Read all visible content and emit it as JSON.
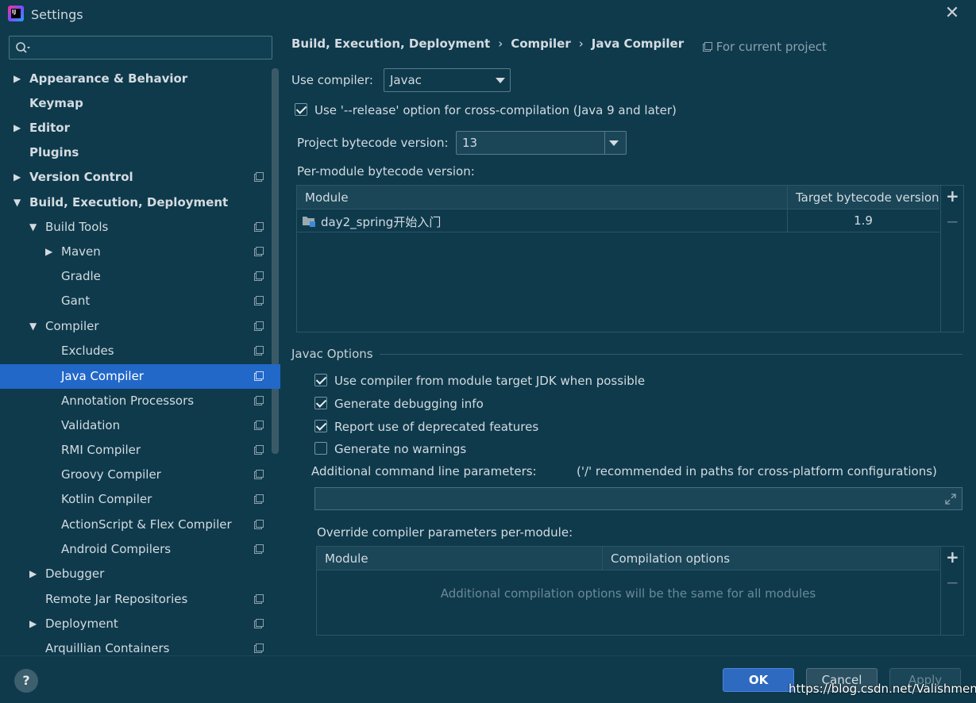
{
  "window": {
    "title": "Settings"
  },
  "search": {
    "placeholder": ""
  },
  "sidebar": {
    "items": [
      {
        "label": "Appearance & Behavior"
      },
      {
        "label": "Keymap"
      },
      {
        "label": "Editor"
      },
      {
        "label": "Plugins"
      },
      {
        "label": "Version Control"
      },
      {
        "label": "Build, Execution, Deployment"
      },
      {
        "label": "Build Tools"
      },
      {
        "label": "Maven"
      },
      {
        "label": "Gradle"
      },
      {
        "label": "Gant"
      },
      {
        "label": "Compiler"
      },
      {
        "label": "Excludes"
      },
      {
        "label": "Java Compiler"
      },
      {
        "label": "Annotation Processors"
      },
      {
        "label": "Validation"
      },
      {
        "label": "RMI Compiler"
      },
      {
        "label": "Groovy Compiler"
      },
      {
        "label": "Kotlin Compiler"
      },
      {
        "label": "ActionScript & Flex Compiler"
      },
      {
        "label": "Android Compilers"
      },
      {
        "label": "Debugger"
      },
      {
        "label": "Remote Jar Repositories"
      },
      {
        "label": "Deployment"
      },
      {
        "label": "Arquillian Containers"
      }
    ]
  },
  "breadcrumb": {
    "items": [
      "Build, Execution, Deployment",
      "Compiler",
      "Java Compiler"
    ],
    "separator": "›",
    "scope": "For current project"
  },
  "compiler": {
    "use_compiler_label": "Use compiler:",
    "use_compiler_value": "Javac",
    "release_option_label": "Use '--release' option for cross-compilation (Java 9 and later)",
    "release_option_checked": true,
    "project_bytecode_label": "Project bytecode version:",
    "project_bytecode_value": "13",
    "per_module_label": "Per-module bytecode version:"
  },
  "module_table": {
    "columns": [
      "Module",
      "Target bytecode version"
    ],
    "rows": [
      {
        "module": "day2_spring开始入门",
        "version": "1.9"
      }
    ]
  },
  "javac_options": {
    "section_title": "Javac Options",
    "checkboxes": [
      {
        "label": "Use compiler from module target JDK when possible",
        "checked": true
      },
      {
        "label": "Generate debugging info",
        "checked": true
      },
      {
        "label": "Report use of deprecated features",
        "checked": true
      },
      {
        "label": "Generate no warnings",
        "checked": false
      }
    ],
    "additional_params_label": "Additional command line parameters:",
    "additional_params_hint": "('/' recommended in paths for cross-platform configurations)",
    "additional_params_value": "",
    "override_label": "Override compiler parameters per-module:"
  },
  "override_table": {
    "columns": [
      "Module",
      "Compilation options"
    ],
    "empty_text": "Additional compilation options will be the same for all modules"
  },
  "footer": {
    "help": "?",
    "ok": "OK",
    "cancel": "Cancel",
    "apply": "Apply",
    "watermark": "https://blog.csdn.net/Valishment"
  },
  "colors": {
    "selection": "#2268c9",
    "background": "#0e3a4c",
    "ok_button": "#2d6ac0"
  }
}
